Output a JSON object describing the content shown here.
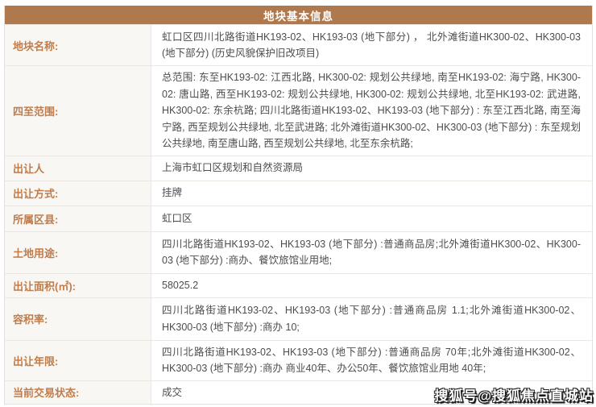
{
  "panel": {
    "title": "地块基本信息"
  },
  "table": {
    "rows": [
      {
        "label": "地块名称:",
        "value": "虹口区四川北路街道HK193-02、HK193-03 (地下部分) ， 北外滩街道HK300-02、HK300-03 (地下部分) (历史风貌保护旧改项目)"
      },
      {
        "label": "四至范围:",
        "value": "总范围: 东至HK193-02: 江西北路, HK300-02: 规划公共绿地, 南至HK193-02: 海宁路, HK300-02: 唐山路, 西至HK193-02: 规划公共绿地, HK300-02: 规划公共绿地, 北至HK193-02: 武进路, HK300-02: 东余杭路; 四川北路街道HK193-02、HK193-03 (地下部分) : 东至江西北路, 南至海宁路, 西至规划公共绿地, 北至武进路; 北外滩街道HK300-02、HK300-03 (地下部分) : 东至规划公共绿地, 南至唐山路, 西至规划公共绿地, 北至东余杭路;"
      },
      {
        "label": "出让人",
        "value": "上海市虹口区规划和自然资源局"
      },
      {
        "label": "出让方式:",
        "value": "挂牌"
      },
      {
        "label": "所属区县:",
        "value": "虹口区"
      },
      {
        "label": "土地用途:",
        "value": "四川北路街道HK193-02、HK193-03 (地下部分) :普通商品房;北外滩街道HK300-02、HK300-03 (地下部分) :商办、餐饮旅馆业用地;"
      },
      {
        "label": "出让面积(㎡):",
        "value": "58025.2"
      },
      {
        "label": "容积率:",
        "value": "四川北路街道HK193-02、HK193-03 (地下部分) :普通商品房 1.1;北外滩街道HK300-02、HK300-03 (地下部分) :商办 10;"
      },
      {
        "label": "出让年限:",
        "value": "四川北路街道HK193-02、HK193-03 (地下部分) :普通商品房 70年;北外滩街道HK300-02、HK300-03 (地下部分) :商办 商业40年、办公50年、餐饮旅馆业用地 40年;"
      },
      {
        "label": "当前交易状态:",
        "value": "成交"
      }
    ]
  },
  "watermark": {
    "text": "搜狐号@搜狐焦点直城站"
  },
  "colors": {
    "header_bg": "#b0794d",
    "header_text": "#ffffff",
    "label_text": "#c07c4a",
    "label_bg": "#f9f7f3",
    "value_text": "#4d4d4d",
    "border": "#ebe7e0"
  }
}
